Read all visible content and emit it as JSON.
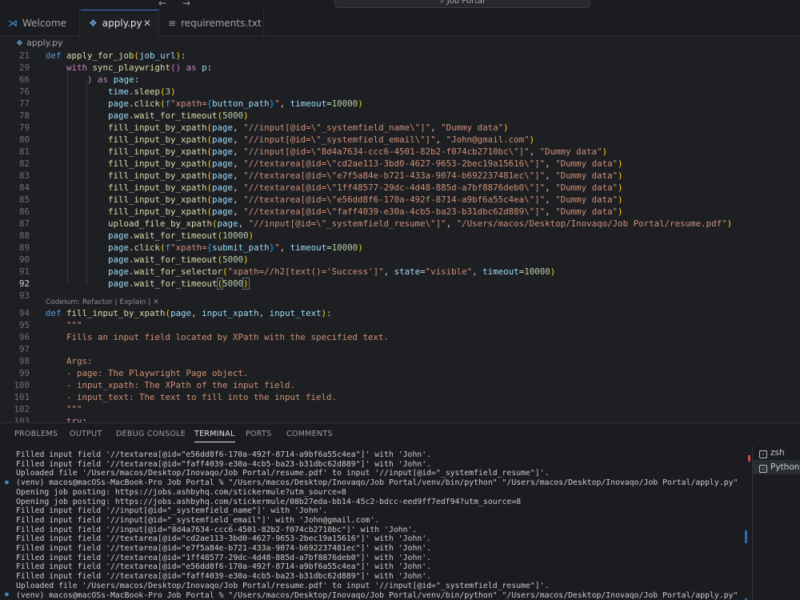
{
  "titlebar": {
    "nav_arrows": "← →",
    "search_text": "⌕ Job Portal"
  },
  "tabs": [
    {
      "label": "Welcome",
      "icon": "vscode-icon"
    },
    {
      "label": "apply.py",
      "icon": "python-file-icon",
      "close": "✕"
    },
    {
      "label": "requirements.txt",
      "icon": "text-file-icon"
    }
  ],
  "breadcrumb": {
    "file": "apply.py"
  },
  "editor": {
    "line_numbers": [
      "21",
      "29",
      "66",
      "76",
      "77",
      "78",
      "79",
      "80",
      "81",
      "82",
      "83",
      "84",
      "85",
      "86",
      "87",
      "88",
      "89",
      "90",
      "91",
      "92",
      "93",
      "94",
      "95",
      "96",
      "97",
      "98",
      "99",
      "100",
      "101",
      "102",
      "103"
    ],
    "codelens": "Codeium: Refactor | Explain | ✕",
    "docstring": {
      "quote": "\"\"\"",
      "summary": "Fills an input field located by XPath with the specified text.",
      "args": "Args:",
      "arg1": "- page: The Playwright Page object.",
      "arg2": "- input_xpath: The XPath of the input field.",
      "arg3": "- input_text: The text to fill into the input field."
    },
    "xpaths": {
      "name": "//input[@id=\\\"_systemfield_name\\\"]",
      "email": "//input[@id=\\\"_systemfield_email\\\"]",
      "uuid1": "//input[@id=\\\"8d4a7634-ccc6-4501-82b2-f074cb2710bc\\\"]",
      "ta1": "//textarea[@id=\\\"cd2ae113-3bd0-4627-9653-2bec19a15616\\\"]",
      "ta2": "//textarea[@id=\\\"e7f5a84e-b721-433a-9074-b692237481ec\\\"]",
      "ta3": "//textarea[@id=\\\"1ff48577-29dc-4d48-885d-a7bf8876deb0\\\"]",
      "ta4": "//textarea[@id=\\\"e56dd8f6-170a-492f-8714-a9bf6a55c4ea\\\"]",
      "ta5": "//textarea[@id=\\\"faff4039-e30a-4cb5-ba23-b31dbc62d889\\\"]",
      "resume": "//input[@id=\\\"_systemfield_resume\\\"]"
    },
    "strings": {
      "dummy": "\"Dummy data\"",
      "email_val": "\"John@gmail.com\"",
      "resume_path": "\"/Users/macos/Desktop/Inovaqo/Job Portal/resume.pdf\"",
      "success_sel": "\"xpath=//h2[text()='Success']\"",
      "visible": "\"visible\""
    },
    "numbers": {
      "sleep": "3",
      "t10000": "10000",
      "t5000": "5000"
    }
  },
  "panel": {
    "tabs": [
      "PROBLEMS",
      "OUTPUT",
      "DEBUG CONSOLE",
      "TERMINAL",
      "PORTS",
      "COMMENTS"
    ],
    "active_tab": "TERMINAL",
    "terminal_lines": [
      "Filled input field '//textarea[@id=\"e56dd8f6-170a-492f-8714-a9bf6a55c4ea\"]' with 'John'.",
      "Filled input field '//textarea[@id=\"faff4039-e30a-4cb5-ba23-b31dbc62d889\"]' with 'John'.",
      "Uploaded file '/Users/macos/Desktop/Inovaqo/Job Portal/resume.pdf' to input '//input[@id=\"_systemfield_resume\"]'.",
      "(venv) macos@macOSs-MacBook-Pro Job Portal % \"/Users/macos/Desktop/Inovaqo/Job Portal/venv/bin/python\" \"/Users/macos/Desktop/Inovaqo/Job Portal/apply.py\"",
      "Opening job posting: https://jobs.ashbyhq.com/stickermule?utm_source=8",
      "Opening job posting: https://jobs.ashbyhq.com/stickermule/08b27eda-bb14-45c2-bdcc-eed9ff7edf94?utm_source=8",
      "Filled input field '//input[@id=\"_systemfield_name\"]' with 'John'.",
      "Filled input field '//input[@id=\"_systemfield_email\"]' with 'John@gmail.com'.",
      "Filled input field '//input[@id=\"8d4a7634-ccc6-4501-82b2-f074cb2710bc\"]' with 'John'.",
      "Filled input field '//textarea[@id=\"cd2ae113-3bd0-4627-9653-2bec19a15616\"]' with 'John'.",
      "Filled input field '//textarea[@id=\"e7f5a84e-b721-433a-9074-b692237481ec\"]' with 'John'.",
      "Filled input field '//textarea[@id=\"1ff48577-29dc-4d48-885d-a7bf8876deb0\"]' with 'John'.",
      "Filled input field '//textarea[@id=\"e56dd8f6-170a-492f-8714-a9bf6a55c4ea\"]' with 'John'.",
      "Filled input field '//textarea[@id=\"faff4039-e30a-4cb5-ba23-b31dbc62d889\"]' with 'John'.",
      "Uploaded file '/Users/macos/Desktop/Inovaqo/Job Portal/resume.pdf' to input '//input[@id=\"_systemfield_resume\"]'.",
      "(venv) macos@macOSs-MacBook-Pro Job Portal % \"/Users/macos/Desktop/Inovaqo/Job Portal/venv/bin/python\" \"/Users/macos/Desktop/Inovaqo/Job Portal/apply.py\""
    ],
    "terminals": [
      {
        "label": "zsh",
        "icon": "terminal-icon"
      },
      {
        "label": "Python",
        "icon": "terminal-icon",
        "active": true
      }
    ]
  }
}
